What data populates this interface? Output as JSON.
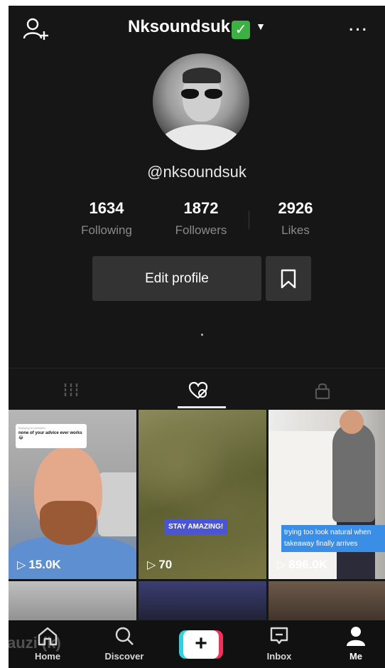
{
  "header": {
    "username": "Nksoundsuk",
    "verified_emoji": "✅",
    "caret": "▼",
    "more": "..."
  },
  "profile": {
    "handle": "@nksoundsuk"
  },
  "stats": {
    "following": {
      "value": "1634",
      "label": "Following"
    },
    "followers": {
      "value": "1872",
      "label": "Followers"
    },
    "likes": {
      "value": "2926",
      "label": "Likes"
    }
  },
  "actions": {
    "edit_profile": "Edit profile"
  },
  "tabs": {
    "selected": "liked"
  },
  "videos": [
    {
      "views": "15.0K",
      "bubble_header": "Replying to comment",
      "bubble_text": "none of your advice ever works 😂"
    },
    {
      "views": "70",
      "caption": "STAY AMAZING!"
    },
    {
      "views": "896.0K",
      "caption": "trying too look natural when takeaway finally arrives"
    }
  ],
  "nav": {
    "home": "Home",
    "discover": "Discover",
    "create": "+",
    "inbox": "Inbox",
    "me": "Me"
  },
  "watermark": "auzi (k)",
  "colors": {
    "background": "#161616",
    "button_bg": "#333333",
    "create_left": "#35d0e0",
    "create_right": "#f0315a",
    "caption_blue": "#3b8ee6",
    "caption_purple": "#4a55d4"
  }
}
